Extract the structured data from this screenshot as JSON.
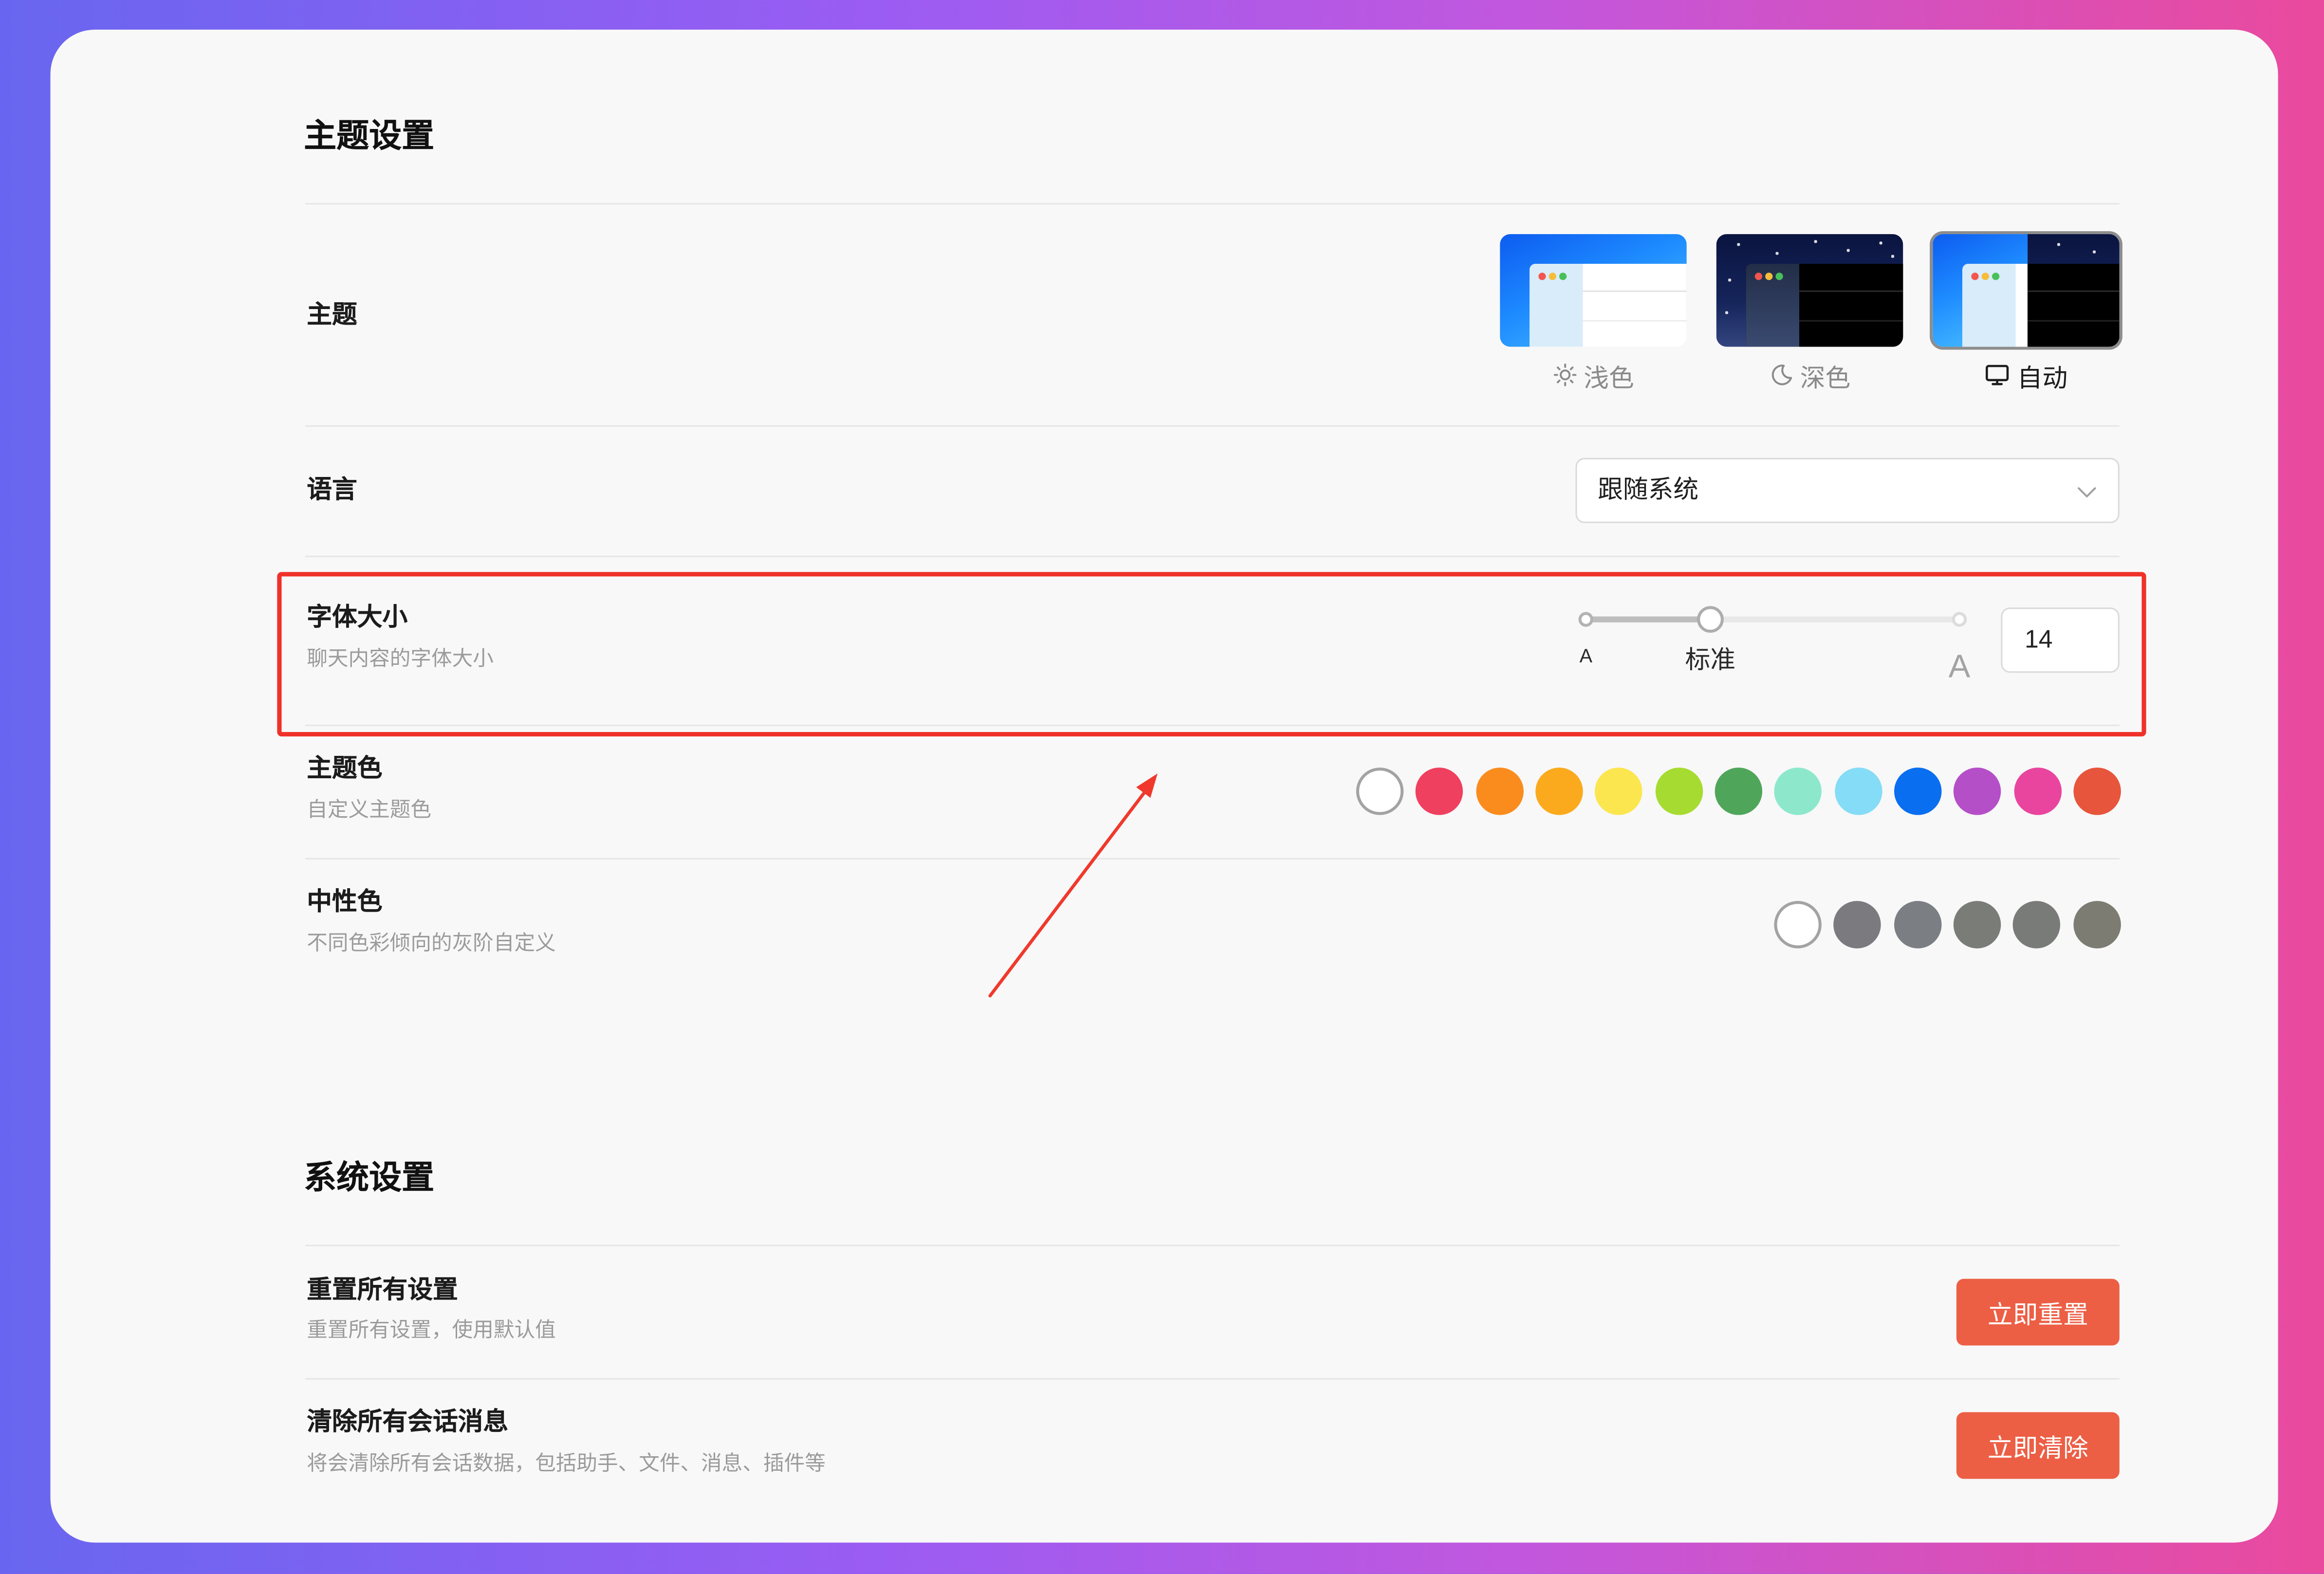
{
  "theme_section": {
    "title": "主题设置"
  },
  "theme": {
    "label": "主题",
    "options": [
      {
        "name": "浅色",
        "icon": "sun-icon",
        "selected": false
      },
      {
        "name": "深色",
        "icon": "moon-icon",
        "selected": false
      },
      {
        "name": "自动",
        "icon": "monitor-icon",
        "selected": true
      }
    ]
  },
  "language": {
    "label": "语言",
    "selected": "跟随系统",
    "icon": "chevron-down-icon"
  },
  "font_size": {
    "label": "字体大小",
    "description": "聊天内容的字体大小",
    "slider": {
      "min_label": "A",
      "mid_label": "标准",
      "max_label": "A",
      "fraction": 0.333
    },
    "value": "14"
  },
  "theme_color": {
    "label": "主题色",
    "description": "自定义主题色",
    "swatches": [
      "#ffffff",
      "#f0405f",
      "#fa8c1e",
      "#fbaa1d",
      "#fbe650",
      "#a6dc31",
      "#4fa65a",
      "#8de8cb",
      "#85dcf7",
      "#0a6ef0",
      "#b54fc8",
      "#e9459e",
      "#e7553c"
    ],
    "selected_index": 0
  },
  "neutral_color": {
    "label": "中性色",
    "description": "不同色彩倾向的灰阶自定义",
    "swatches": [
      "#ffffff",
      "#7a7a7f",
      "#7b7e83",
      "#7a7c77",
      "#797b78",
      "#7c7c73"
    ],
    "selected_index": 0
  },
  "system_section": {
    "title": "系统设置"
  },
  "reset": {
    "label": "重置所有设置",
    "description": "重置所有设置，使用默认值",
    "button": "立即重置"
  },
  "clear": {
    "label": "清除所有会话消息",
    "description": "将会清除所有会话数据，包括助手、文件、消息、插件等",
    "button": "立即清除"
  },
  "colors": {
    "danger_button": "#ec5f45",
    "highlight_box": "#f0312a",
    "annotation_arrow": "#f0392c",
    "background_gradient": [
      "#6866f0",
      "#9b5cf3",
      "#c257dd",
      "#ea4a9d"
    ]
  }
}
